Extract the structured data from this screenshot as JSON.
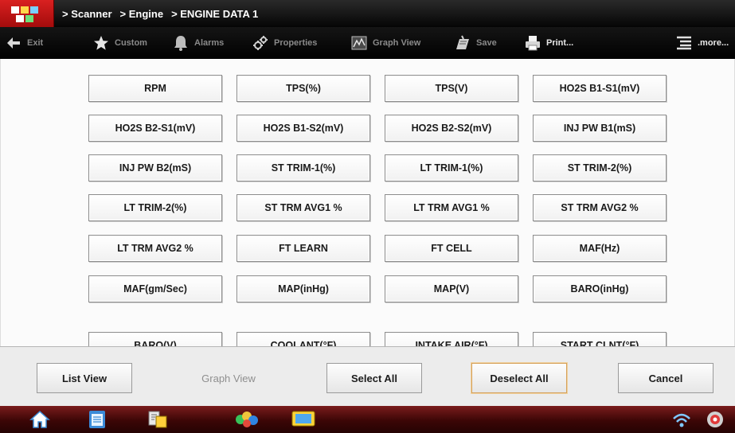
{
  "breadcrumb": [
    "> Scanner",
    "> Engine",
    "> ENGINE DATA 1"
  ],
  "toolbar": {
    "items": [
      {
        "label": "Exit",
        "icon": "back-arrow-icon"
      },
      {
        "label": "Custom",
        "icon": "star-icon"
      },
      {
        "label": "Alarms",
        "icon": "bell-icon"
      },
      {
        "label": "Properties",
        "icon": "properties-icon"
      },
      {
        "label": "Graph View",
        "icon": "graph-icon"
      },
      {
        "label": "Save",
        "icon": "save-icon"
      },
      {
        "label": "Print...",
        "icon": "printer-icon"
      }
    ],
    "more_label": ".more...",
    "more_icon": "menu-list-icon"
  },
  "pids": [
    "RPM",
    "TPS(%)",
    "TPS(V)",
    "HO2S B1-S1(mV)",
    "HO2S B2-S1(mV)",
    "HO2S B1-S2(mV)",
    "HO2S B2-S2(mV)",
    "INJ PW B1(mS)",
    "INJ PW B2(mS)",
    "ST TRIM-1(%)",
    "LT TRIM-1(%)",
    "ST TRIM-2(%)",
    "LT TRIM-2(%)",
    "ST TRM AVG1 %",
    "LT TRM AVG1 %",
    "ST TRM AVG2 %",
    "LT TRM AVG2 %",
    "FT LEARN",
    "FT CELL",
    "MAF(Hz)",
    "MAF(gm/Sec)",
    "MAP(inHg)",
    "MAP(V)",
    "BARO(inHg)",
    "BARO(V)",
    "COOLANT(°F)",
    "INTAKE AIR(°F)",
    "START CLNT(°F)"
  ],
  "actions": {
    "list_view": "List View",
    "graph_view": "Graph View",
    "select_all": "Select All",
    "deselect_all": "Deselect All",
    "cancel": "Cancel"
  },
  "taskbar": {
    "icons": [
      "home-icon",
      "notepad-icon",
      "data-transfer-icon",
      "app-launcher-icon",
      "screen-icon",
      "wifi-icon",
      "scanner-icon"
    ]
  },
  "colors": {
    "title_bar": "#050505",
    "logo_red": "#d92020",
    "taskbar_red": "#5a0b0b",
    "focus_border": "#d6a15a"
  }
}
